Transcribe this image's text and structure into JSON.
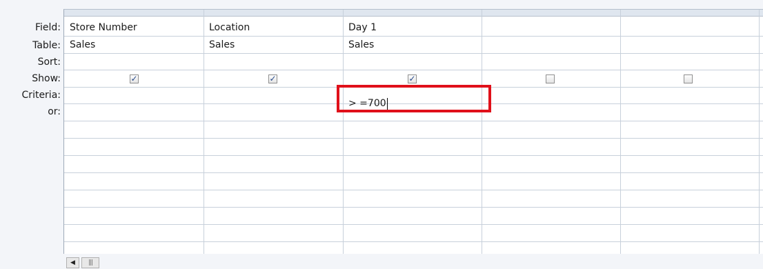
{
  "row_labels": [
    "Field:",
    "Table:",
    "Sort:",
    "Show:",
    "Criteria:",
    "or:"
  ],
  "columns": [
    {
      "field": "Store Number",
      "table": "Sales",
      "sort": "",
      "show": true,
      "criteria": ""
    },
    {
      "field": "Location",
      "table": "Sales",
      "sort": "",
      "show": true,
      "criteria": ""
    },
    {
      "field": "Day 1",
      "table": "Sales",
      "sort": "",
      "show": true,
      "criteria": "> =700"
    },
    {
      "field": "",
      "table": "",
      "sort": "",
      "show": false,
      "criteria": ""
    },
    {
      "field": "",
      "table": "",
      "sort": "",
      "show": false,
      "criteria": ""
    }
  ],
  "checked_mark": "✓",
  "highlight_color": "#e0101a",
  "scroll_left_glyph": "◀",
  "scroll_thumb_glyph": "|||"
}
